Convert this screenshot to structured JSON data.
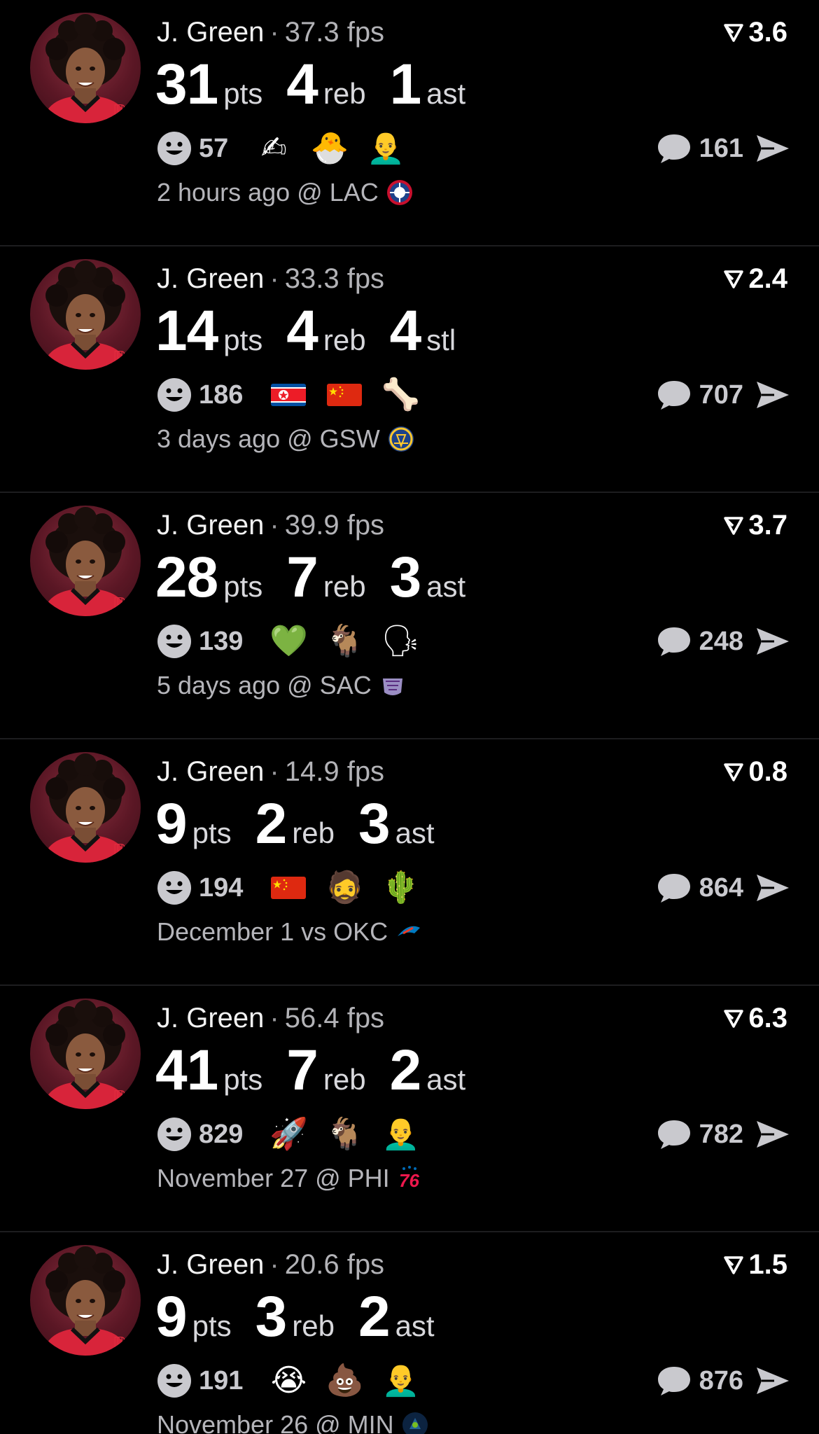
{
  "colors": {
    "background": "#000000",
    "text": "#ffffff",
    "muted": "#b5b5ba",
    "divider": "#1d1d1f"
  },
  "posts": [
    {
      "player": "J. Green",
      "fps": "37.3 fps",
      "score": "3.6",
      "stats": [
        {
          "value": "31",
          "unit": "pts"
        },
        {
          "value": "4",
          "unit": "reb"
        },
        {
          "value": "1",
          "unit": "ast"
        }
      ],
      "reactions_count": "57",
      "reaction_icons": [
        "pencil-sketch-person-icon",
        "hatching-chick-icon",
        "bald-man-face-icon"
      ],
      "comments_count": "161",
      "footer": "2 hours ago @ LAC",
      "team_logo": "lac-clippers-logo"
    },
    {
      "player": "J. Green",
      "fps": "33.3 fps",
      "score": "2.4",
      "stats": [
        {
          "value": "14",
          "unit": "pts"
        },
        {
          "value": "4",
          "unit": "reb"
        },
        {
          "value": "4",
          "unit": "stl"
        }
      ],
      "reactions_count": "186",
      "reaction_icons": [
        "north-korea-flag-icon",
        "china-flag-icon",
        "skeleton-walker-icon"
      ],
      "comments_count": "707",
      "footer": "3 days ago @ GSW",
      "team_logo": "gsw-warriors-logo"
    },
    {
      "player": "J. Green",
      "fps": "39.9 fps",
      "score": "3.7",
      "stats": [
        {
          "value": "28",
          "unit": "pts"
        },
        {
          "value": "7",
          "unit": "reb"
        },
        {
          "value": "3",
          "unit": "ast"
        }
      ],
      "reactions_count": "139",
      "reaction_icons": [
        "green-heart-icon",
        "goat-icon",
        "shouting-man-icon"
      ],
      "comments_count": "248",
      "footer": "5 days ago @ SAC",
      "team_logo": "sac-kings-logo"
    },
    {
      "player": "J. Green",
      "fps": "14.9 fps",
      "score": "0.8",
      "stats": [
        {
          "value": "9",
          "unit": "pts"
        },
        {
          "value": "2",
          "unit": "reb"
        },
        {
          "value": "3",
          "unit": "ast"
        }
      ],
      "reactions_count": "194",
      "reaction_icons": [
        "china-flag-icon",
        "man-face-icon",
        "cactus-icon"
      ],
      "comments_count": "864",
      "footer": "December 1 vs OKC",
      "team_logo": "okc-thunder-logo"
    },
    {
      "player": "J. Green",
      "fps": "56.4 fps",
      "score": "6.3",
      "stats": [
        {
          "value": "41",
          "unit": "pts"
        },
        {
          "value": "7",
          "unit": "reb"
        },
        {
          "value": "2",
          "unit": "ast"
        }
      ],
      "reactions_count": "829",
      "reaction_icons": [
        "rocket-icon",
        "goat-icon",
        "bald-man-face-icon"
      ],
      "comments_count": "782",
      "footer": "November 27 @ PHI",
      "team_logo": "phi-76ers-logo"
    },
    {
      "player": "J. Green",
      "fps": "20.6 fps",
      "score": "1.5",
      "stats": [
        {
          "value": "9",
          "unit": "pts"
        },
        {
          "value": "3",
          "unit": "reb"
        },
        {
          "value": "2",
          "unit": "ast"
        }
      ],
      "reactions_count": "191",
      "reaction_icons": [
        "crying-face-icon",
        "pile-of-poo-icon",
        "bald-man-face-icon"
      ],
      "comments_count": "876",
      "footer": "November 26 @ MIN",
      "team_logo": "min-timberwolves-logo"
    }
  ]
}
